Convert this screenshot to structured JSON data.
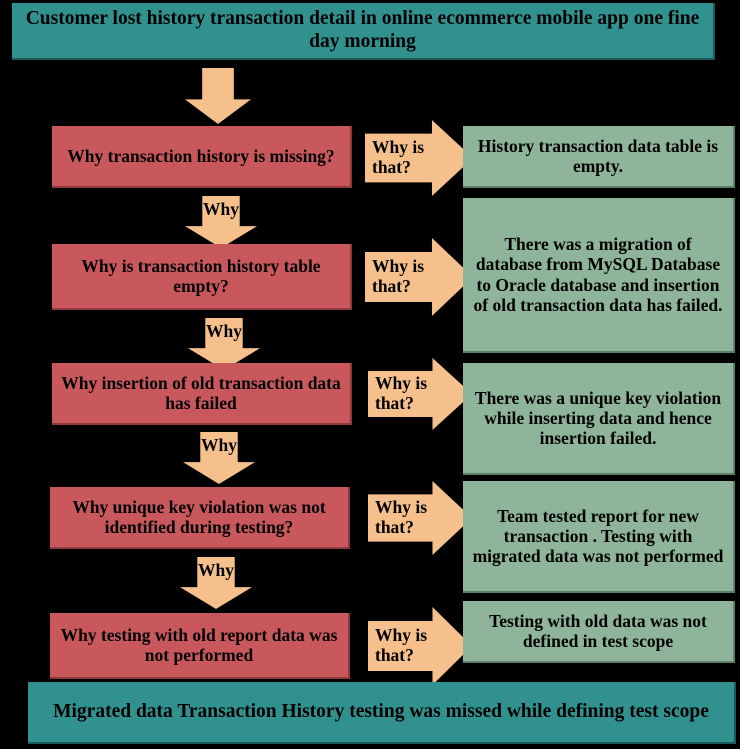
{
  "diagram": {
    "type": "5-whys-root-cause-analysis",
    "problem_statement": "Customer lost history transaction detail  in online ecommerce mobile app one fine day morning",
    "conclusion": "Migrated data Transaction History testing was missed while defining test scope",
    "connector_down_label": "Why",
    "connector_right_label": "Why is that?",
    "colors": {
      "background": "#000000",
      "banner": "#31918F",
      "question": "#C9585C",
      "answer": "#8EB499",
      "arrow": "#F5C08B",
      "text": "#000000"
    },
    "levels": [
      {
        "index": 1,
        "question": "Why transaction history is missing?",
        "answer": "History transaction data table is empty."
      },
      {
        "index": 2,
        "question": "Why is transaction history table empty?",
        "answer": "There was a migration of database from MySQL Database to Oracle database and insertion of old transaction data has failed."
      },
      {
        "index": 3,
        "question": "Why insertion of old transaction data has failed",
        "answer": "There was a unique key violation while inserting data and hence insertion failed."
      },
      {
        "index": 4,
        "question": "Why unique key violation was not identified during testing?",
        "answer": "Team tested report for new transaction . Testing with migrated data was not performed"
      },
      {
        "index": 5,
        "question": "Why testing with old report data was not performed",
        "answer": "Testing with old data was not defined in test scope"
      }
    ]
  }
}
